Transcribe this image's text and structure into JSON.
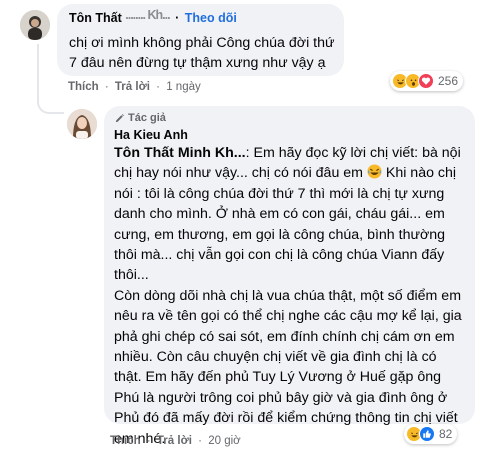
{
  "comment1": {
    "author_visible": "Tôn Thất",
    "author_redacted": "........ Kh...",
    "follow_label": "Theo dõi",
    "text": "chị ơi mình không phải Công chúa đời thứ 7 đâu nên đừng tự thậm xưng như vậy ạ",
    "actions": {
      "like": "Thích",
      "reply": "Trả lời",
      "time": "1 ngày"
    },
    "reactions": {
      "icons": [
        "haha-icon",
        "wow-icon",
        "love-icon"
      ],
      "count": "256"
    }
  },
  "comment2": {
    "badge": "Tác giả",
    "author": "Ha Kieu Anh",
    "mention": "Tôn Thất Minh Kh...",
    "text_1": ": Em hãy đọc kỹ lời chị viết: bà nội chị hay nói như vậy... chị có nói đâu em ",
    "text_2": " Khi nào chị nói : tôi là công chúa đời thứ 7 thì mới là chị tự xưng danh cho mình. Ở nhà em có con gái, cháu gái... em cưng, em thương, em gọi là công chúa, bình thường thôi mà... chị vẫn gọi con chị là công chúa Viann đấy thôi...",
    "text_3": "Còn dòng dõi nhà chị là vua chúa thật, một số điểm em nêu ra về tên gọi có thể chị nghe các cậu mợ kể lại, gia phả ghi chép có sai sót, em đính chính chị cám ơn em nhiều. Còn câu chuyện chị viết về gia đình chị là có thật. Em hãy đến phủ Tuy Lý Vương ở Huế gặp ông Phú là người trông coi phủ bây giờ và gia đình ông ở Phủ đó đã mấy đời rồi để kiểm chứng thông tin chị viết em nhé.",
    "actions": {
      "like": "Thích",
      "reply": "Trả lời",
      "time": "20 giờ"
    },
    "reactions": {
      "icons": [
        "haha-icon",
        "like-icon"
      ],
      "count": "82"
    }
  },
  "colors": {
    "bubble": "#f0f2f5",
    "link": "#216fdb",
    "meta": "#65676b"
  }
}
